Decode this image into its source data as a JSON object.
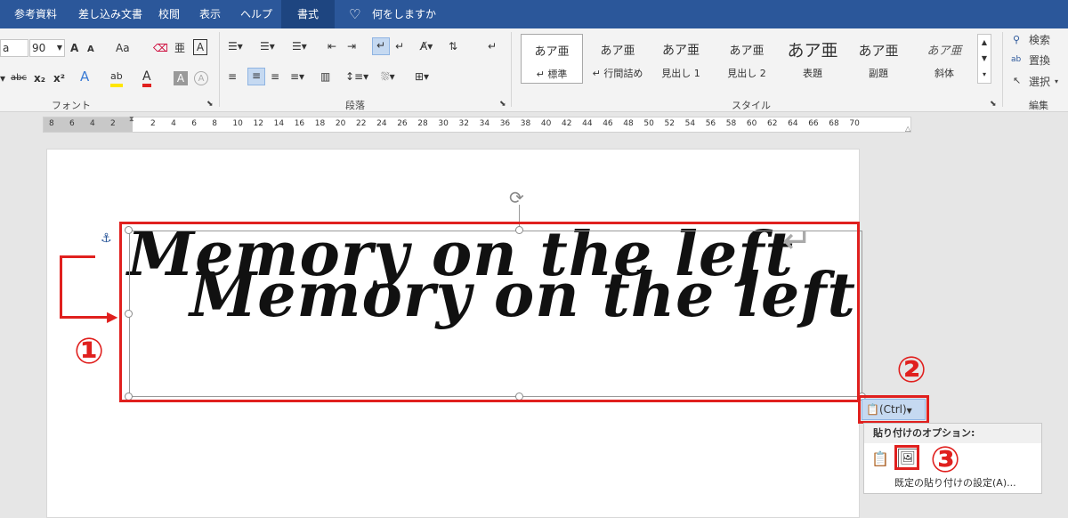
{
  "tabs": [
    {
      "label": "参考資料"
    },
    {
      "label": "差し込み文書"
    },
    {
      "label": "校閲"
    },
    {
      "label": "表示"
    },
    {
      "label": "ヘルプ"
    },
    {
      "label": "書式"
    }
  ],
  "tell_me": "何をしますか",
  "font": {
    "name_value": "a",
    "size_value": "90",
    "group_label": "フォント",
    "grow": "A",
    "shrink": "A",
    "case": "Aa",
    "strike": "abc",
    "subscript": "x₂",
    "superscript": "x²",
    "effects": "A",
    "highlight": "ab",
    "color": "A",
    "shade": "A",
    "border": "A"
  },
  "paragraph": {
    "group_label": "段落"
  },
  "styles": {
    "group_label": "スタイル",
    "items": [
      {
        "sample": "あア亜",
        "name": "↵ 標準"
      },
      {
        "sample": "あア亜",
        "name": "↵ 行間詰め"
      },
      {
        "sample": "あア亜",
        "name": "見出し 1"
      },
      {
        "sample": "あア亜",
        "name": "見出し 2"
      },
      {
        "sample": "あア亜",
        "name": "表題"
      },
      {
        "sample": "あア亜",
        "name": "副題"
      },
      {
        "sample": "あア亜",
        "name": "斜体"
      }
    ]
  },
  "editing": {
    "group_label": "編集",
    "find": "検索",
    "replace": "置換",
    "select": "選択"
  },
  "ruler": {
    "left_ticks": [
      "8",
      "6",
      "4",
      "2"
    ],
    "ticks": [
      "2",
      "4",
      "6",
      "8",
      "10",
      "12",
      "14",
      "16",
      "18",
      "20",
      "22",
      "24",
      "26",
      "28",
      "30",
      "32",
      "34",
      "36",
      "38",
      "40",
      "42",
      "44",
      "46",
      "48",
      "50",
      "52",
      "54",
      "56",
      "58",
      "60",
      "62",
      "64",
      "66",
      "68",
      "70"
    ]
  },
  "picture_text": "Memory on the left",
  "paste_button": {
    "label": "(Ctrl)"
  },
  "paste_popup": {
    "title": "貼り付けのオプション:",
    "default_link": "既定の貼り付けの設定(A)..."
  },
  "markers": {
    "one": "①",
    "two": "②",
    "three": "③"
  },
  "colors": {
    "accent": "#2b579a",
    "highlight": "#e0201e"
  }
}
